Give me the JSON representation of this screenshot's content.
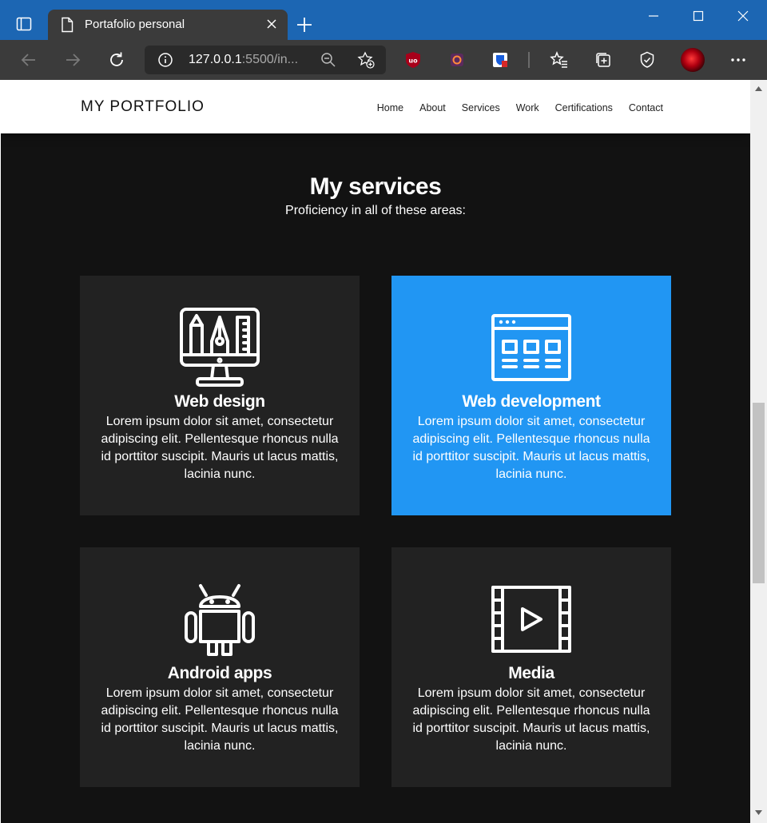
{
  "browser": {
    "tab_title": "Portafolio personal",
    "url_host": "127.0.0.1",
    "url_rest": ":5500/in...",
    "colors": {
      "titlebar": "#1c66b3",
      "toolbar": "#3b3b3b"
    }
  },
  "site": {
    "brand": "MY PORTFOLIO",
    "nav": [
      "Home",
      "About",
      "Services",
      "Work",
      "Certifications",
      "Contact"
    ]
  },
  "services": {
    "title": "My services",
    "subtitle": "Proficiency in all of these areas:",
    "accent_color": "#2196f3",
    "cards": [
      {
        "icon": "monitor-design-icon",
        "title": "Web design",
        "text": "Lorem ipsum dolor sit amet, consectetur adipiscing elit. Pellentesque rhoncus nulla id porttitor suscipit. Mauris ut lacus mattis, lacinia nunc."
      },
      {
        "icon": "browser-window-icon",
        "title": "Web development",
        "text": "Lorem ipsum dolor sit amet, consectetur adipiscing elit. Pellentesque rhoncus nulla id porttitor suscipit. Mauris ut lacus mattis, lacinia nunc."
      },
      {
        "icon": "android-icon",
        "title": "Android apps",
        "text": "Lorem ipsum dolor sit amet, consectetur adipiscing elit. Pellentesque rhoncus nulla id porttitor suscipit. Mauris ut lacus mattis, lacinia nunc."
      },
      {
        "icon": "film-play-icon",
        "title": "Media",
        "text": "Lorem ipsum dolor sit amet, consectetur adipiscing elit. Pellentesque rhoncus nulla id porttitor suscipit. Mauris ut lacus mattis, lacinia nunc."
      }
    ]
  }
}
